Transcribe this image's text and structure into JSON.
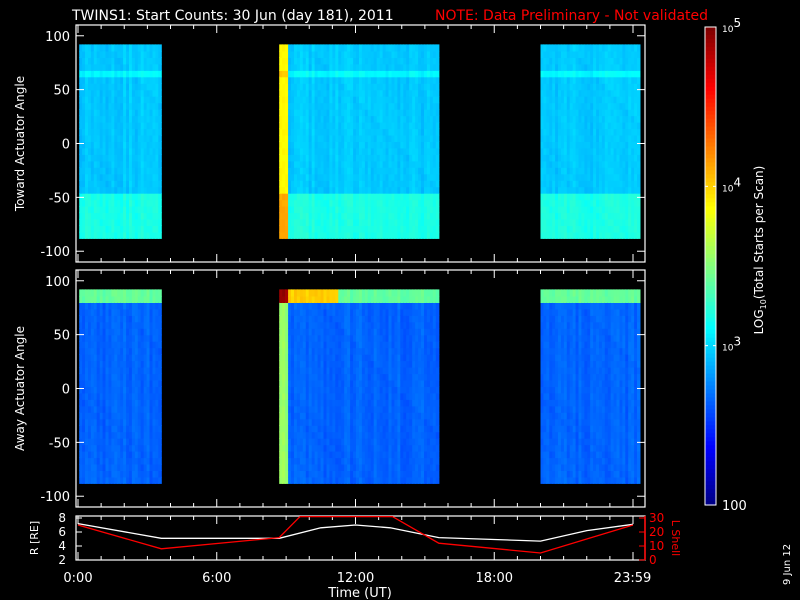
{
  "title": "TWINS1: Start Counts: 30 Jun (day 181), 2011",
  "note": "NOTE: Data Preliminary - Not validated",
  "side_date": "9 Jun 12",
  "colors": {
    "background": "#000000",
    "axis": "#ffffff",
    "note": "#ff0000",
    "lshell": "#ff0000",
    "r": "#ffffff"
  },
  "chart_data": [
    {
      "type": "heatmap",
      "ylabel": "Toward Actuator Angle",
      "ylim": [
        -110,
        110
      ],
      "yticks": [
        "100",
        "50",
        "0",
        "-50",
        "-100"
      ],
      "ytick_values": [
        100,
        50,
        0,
        -50,
        -100
      ],
      "data_blocks_hours": [
        [
          0.05,
          3.6
        ],
        [
          8.7,
          15.6
        ],
        [
          20.0,
          24.3
        ]
      ],
      "angle_range": [
        -88,
        90
      ],
      "typical_log_counts": 2.9
    },
    {
      "type": "heatmap",
      "ylabel": "Away Actuator Angle",
      "ylim": [
        -110,
        110
      ],
      "yticks": [
        "100",
        "50",
        "0",
        "-50",
        "-100"
      ],
      "ytick_values": [
        100,
        50,
        0,
        -50,
        -100
      ],
      "data_blocks_hours": [
        [
          0.05,
          3.6
        ],
        [
          8.7,
          15.6
        ],
        [
          20.0,
          24.3
        ]
      ],
      "angle_range": [
        -88,
        90
      ],
      "typical_log_counts": 2.6
    },
    {
      "type": "line",
      "xlabel": "Time (UT)",
      "xticks": [
        "0:00",
        "6:00",
        "12:00",
        "18:00",
        "23:59"
      ],
      "xtick_values": [
        0,
        6,
        12,
        18,
        23.98
      ],
      "ylabel": "R [RE]",
      "yticks": [
        "8",
        "6",
        "4",
        "2"
      ],
      "ylim": [
        2,
        8
      ],
      "ylabel2": "L Shell",
      "yticks2": [
        "30",
        "20",
        "10",
        "0"
      ],
      "ylim2": [
        0,
        30
      ],
      "series": [
        {
          "name": "R",
          "axis": "left",
          "x": [
            0,
            3.6,
            8.7,
            10.5,
            12,
            13.5,
            15.6,
            20.0,
            22,
            24
          ],
          "y": [
            7.2,
            5.1,
            5.1,
            6.6,
            7.0,
            6.6,
            5.2,
            4.7,
            6.2,
            7.1
          ]
        },
        {
          "name": "L Shell",
          "axis": "right",
          "x": [
            0,
            3.6,
            8.7,
            9.6,
            13.6,
            15.6,
            20.0,
            24
          ],
          "y": [
            25,
            8,
            16,
            31,
            31,
            12,
            5,
            25
          ]
        }
      ]
    }
  ],
  "colorbar": {
    "label": "LOG10(Total Starts per Scan)",
    "label_main": "LOG",
    "label_sub": "10",
    "label_rest": "(Total Starts per Scan)",
    "ticks": [
      {
        "base": "10",
        "exp": "5",
        "value": 5
      },
      {
        "base": "10",
        "exp": "4",
        "value": 4
      },
      {
        "base": "10",
        "exp": "3",
        "value": 3
      },
      {
        "base": "100",
        "exp": "",
        "value": 2
      }
    ],
    "range": [
      2,
      5
    ]
  }
}
